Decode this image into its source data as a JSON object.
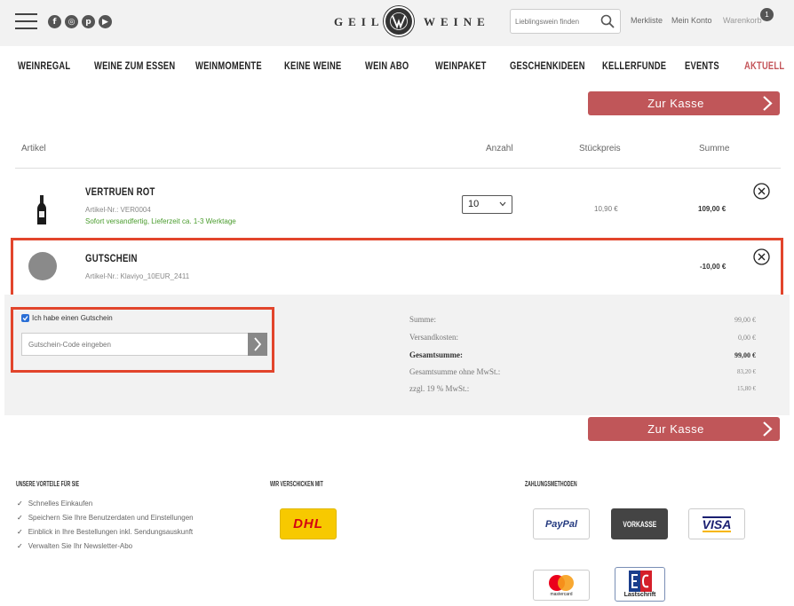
{
  "header": {
    "search_placeholder": "Lieblingswein finden",
    "logo_left": "GEILE",
    "logo_right": "WEINE",
    "links": {
      "merkliste": "Merkliste",
      "konto": "Mein Konto",
      "warenkorb": "Warenkorb"
    },
    "cart_count": "1",
    "socials": [
      "facebook-icon",
      "instagram-icon",
      "pinterest-icon",
      "youtube-icon"
    ]
  },
  "nav": [
    "WEINREGAL",
    "WEINE ZUM ESSEN",
    "WEINMOMENTE",
    "KEINE WEINE",
    "WEIN ABO",
    "WEINPAKET",
    "GESCHENKIDEEN",
    "KELLERFUNDE",
    "EVENTS",
    "AKTUELL"
  ],
  "checkout_label": "Zur Kasse",
  "table": {
    "artikel": "Artikel",
    "anzahl": "Anzahl",
    "stueckpreis": "Stückpreis",
    "summe": "Summe"
  },
  "items": [
    {
      "title": "VERTRUEN ROT",
      "sku": "Artikel-Nr.: VER0004",
      "stock": "Sofort versandfertig, Lieferzeit ca. 1-3 Werktage",
      "qty": "10",
      "unit_price": "10,90 €",
      "sum": "109,00 €"
    },
    {
      "title": "GUTSCHEIN",
      "sku": "Artikel-Nr.: Klaviyo_10EUR_2411",
      "sum": "-10,00 €"
    }
  ],
  "voucher": {
    "checkbox_label": "Ich habe einen Gutschein",
    "placeholder": "Gutschein-Code eingeben"
  },
  "summary": [
    {
      "label": "Summe:",
      "value": "99,00 €"
    },
    {
      "label": "Versandkosten:",
      "value": "0,00 €"
    },
    {
      "label": "Gesamtsumme:",
      "value": "99,00 €"
    },
    {
      "label": "Gesamtsumme ohne MwSt.:",
      "value": "83,20 €"
    },
    {
      "label": "zzgl. 19 % MwSt.:",
      "value": "15,80 €"
    }
  ],
  "footer": {
    "vorteile_title": "UNSERE VORTEILE FÜR SIE",
    "vorteile": [
      "Schnelles Einkaufen",
      "Speichern Sie Ihre Benutzerdaten und Einstellungen",
      "Einblick in Ihre Bestellungen inkl. Sendungsauskunft",
      "Verwalten Sie Ihr Newsletter-Abo"
    ],
    "versand_title": "WIR VERSCHICKEN MIT",
    "versand": "DHL",
    "zahlung_title": "ZAHLUNGSMETHODEN",
    "zahlung": {
      "paypal": "PayPal",
      "vorkasse": "VORKASSE",
      "visa": "VISA",
      "mastercard": "mastercard",
      "lastschrift": "Lastschrift"
    }
  },
  "colors": {
    "accent": "#c05659",
    "highlight": "#e2452c",
    "stock_green": "#4a9c2d"
  }
}
